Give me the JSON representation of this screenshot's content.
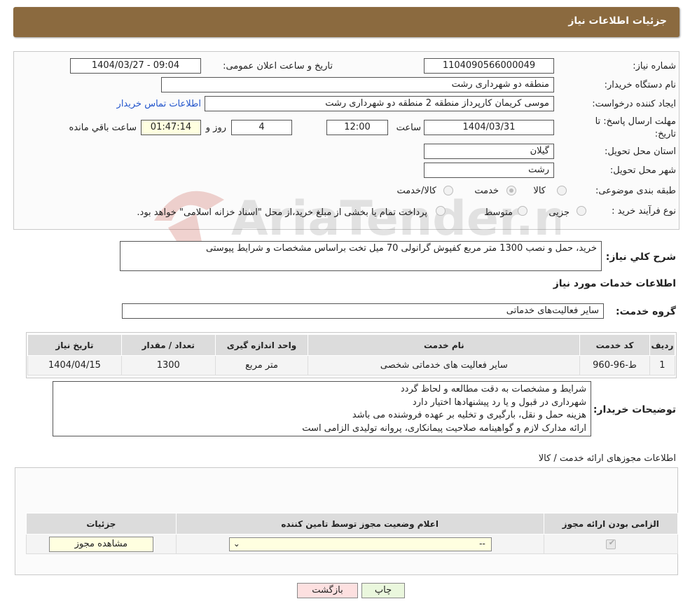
{
  "header": {
    "title": "جزئیات اطلاعات نیاز"
  },
  "form": {
    "need_number_label": "شماره نیاز:",
    "need_number": "1104090566000049",
    "announce_label": "تاریخ و ساعت اعلان عمومی:",
    "announce_value": "1404/03/27 - 09:04",
    "buyer_org_label": "نام دستگاه خریدار:",
    "buyer_org": "منطقه دو شهرداری رشت",
    "requester_label": "ایجاد کننده درخواست:",
    "requester": "موسی کریمان کارپرداز منطقه 2 منطقه دو شهرداری رشت",
    "contact_link": "اطلاعات تماس خریدار",
    "deadline_label_1": "مهلت ارسال پاسخ: تا",
    "deadline_label_2": "تاریخ:",
    "deadline_date": "1404/03/31",
    "time_label": "ساعت",
    "deadline_time": "12:00",
    "days_value": "4",
    "days_label": "روز و",
    "remaining_time": "01:47:14",
    "remaining_label": "ساعت باقي مانده",
    "province_label": "استان محل تحویل:",
    "province": "گیلان",
    "city_label": "شهر محل تحویل:",
    "city": "رشت",
    "category_label": "طبقه بندی موضوعی:",
    "category_options": [
      "کالا",
      "خدمت",
      "کالا/خدمت"
    ],
    "category_selected": "خدمت",
    "process_label": "نوع فرآیند خرید :",
    "process_options": [
      "جزیی",
      "متوسط"
    ],
    "process_note": "پرداخت تمام یا بخشی از مبلغ خرید،از محل \"اسناد خزانه اسلامی\" خواهد بود."
  },
  "summary": {
    "label": "شرح کلي نیاز:",
    "text": "خرید، حمل و نصب 1300 متر مربع کفپوش گرانولی 70 میل تخت براساس مشخصات و شرایط پیوستی"
  },
  "services": {
    "section_title": "اطلاعات خدمات مورد نیاز",
    "group_label": "گروه خدمت:",
    "group_value": "سایر فعالیت‌های خدماتی",
    "columns": [
      "ردیف",
      "کد خدمت",
      "نام خدمت",
      "واحد اندازه گیری",
      "تعداد / مقدار",
      "تاریخ نیاز"
    ],
    "rows": [
      [
        "1",
        "ط-96-960",
        "سایر فعالیت های خدماتی شخصی",
        "متر مربع",
        "1300",
        "1404/04/15"
      ]
    ]
  },
  "buyer_notes": {
    "label": "توضیحات خریدار:",
    "lines": [
      "شرایط و مشخصات به دقت مطالعه و لحاظ گردد",
      "شهرداری در قبول و یا رد پیشنهادها اختیار دارد",
      "هزینه حمل و نقل، بارگیری و تخلیه بر عهده فروشنده می باشد",
      "ارائه مدارک لازم و گواهینامه صلاحیت پیمانکاری، پروانه تولیدی الزامی است"
    ]
  },
  "permits": {
    "title": "اطلاعات مجوزهای ارائه خدمت / کالا",
    "columns": [
      "الزامی بودن ارائه مجوز",
      "اعلام وضعیت مجوز توسط تامین کننده",
      "جزئیات"
    ],
    "select_value": "--",
    "view_button": "مشاهده مجوز"
  },
  "actions": {
    "print": "چاپ",
    "back": "بازگشت"
  },
  "watermark": {
    "text": "AriaTender.neT"
  }
}
